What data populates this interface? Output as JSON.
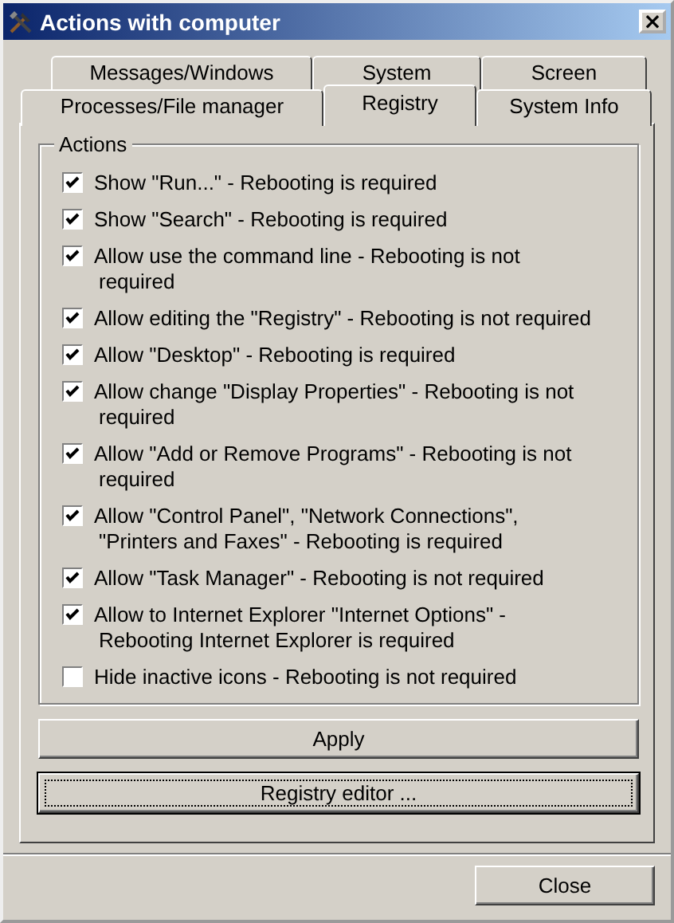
{
  "window": {
    "title": "Actions with computer",
    "close_glyph": "×"
  },
  "tab_rows": [
    {
      "tabs": [
        {
          "label": "Messages/Windows",
          "selected": false
        },
        {
          "label": "System",
          "selected": false
        },
        {
          "label": "Screen",
          "selected": false
        }
      ]
    },
    {
      "tabs": [
        {
          "label": "Processes/File manager",
          "selected": false
        },
        {
          "label": "Registry",
          "selected": true
        },
        {
          "label": "System Info",
          "selected": false
        }
      ]
    }
  ],
  "group": {
    "title": "Actions",
    "options": [
      {
        "lines": [
          "Show \"Run...\" - Rebooting is required"
        ],
        "checked": true
      },
      {
        "lines": [
          "Show \"Search\" - Rebooting is required"
        ],
        "checked": true
      },
      {
        "lines": [
          "Allow use the command line - Rebooting is not",
          "required"
        ],
        "checked": true
      },
      {
        "lines": [
          "Allow editing the \"Registry\" - Rebooting is not required"
        ],
        "checked": true
      },
      {
        "lines": [
          "Allow \"Desktop\" - Rebooting is required"
        ],
        "checked": true
      },
      {
        "lines": [
          "Allow change \"Display Properties\" - Rebooting is not",
          "required"
        ],
        "checked": true
      },
      {
        "lines": [
          "Allow \"Add or Remove Programs\" - Rebooting is not",
          "required"
        ],
        "checked": true
      },
      {
        "lines": [
          "Allow \"Control Panel\", \"Network Connections\",",
          "\"Printers and Faxes\" - Rebooting is required"
        ],
        "checked": true
      },
      {
        "lines": [
          "Allow \"Task Manager\" - Rebooting is not required"
        ],
        "checked": true
      },
      {
        "lines": [
          "Allow to Internet Explorer \"Internet Options\" -",
          "Rebooting Internet Explorer is required"
        ],
        "checked": true
      },
      {
        "lines": [
          "Hide inactive icons - Rebooting is not required"
        ],
        "checked": false
      }
    ]
  },
  "buttons": [
    {
      "label": "Apply",
      "focused": false
    },
    {
      "label": "Registry editor ...",
      "focused": true
    }
  ],
  "close_button": "Close"
}
